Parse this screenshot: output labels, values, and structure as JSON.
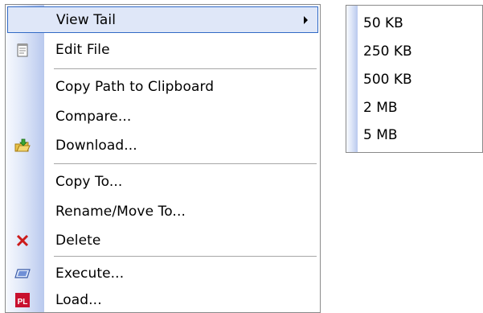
{
  "menu": {
    "items": [
      {
        "label": "View Tail",
        "icon": null
      },
      {
        "label": "Edit File",
        "icon": "notepad-icon"
      },
      {
        "label": "Copy Path to Clipboard",
        "icon": null
      },
      {
        "label": "Compare...",
        "icon": null
      },
      {
        "label": "Download...",
        "icon": "download-folder-icon"
      },
      {
        "label": "Copy To...",
        "icon": null
      },
      {
        "label": "Rename/Move To...",
        "icon": null
      },
      {
        "label": "Delete",
        "icon": "delete-x-icon"
      },
      {
        "label": "Execute...",
        "icon": "execute-icon"
      },
      {
        "label": "Load...",
        "icon": "pl-load-icon"
      }
    ]
  },
  "submenu": {
    "items": [
      "50 KB",
      "250 KB",
      "500 KB",
      "2 MB",
      "5 MB"
    ]
  },
  "colors": {
    "highlight_border": "#316ac5",
    "gutter": "#b9c9ee",
    "delete_red": "#cc1a1a",
    "pl_red": "#c8102e"
  }
}
